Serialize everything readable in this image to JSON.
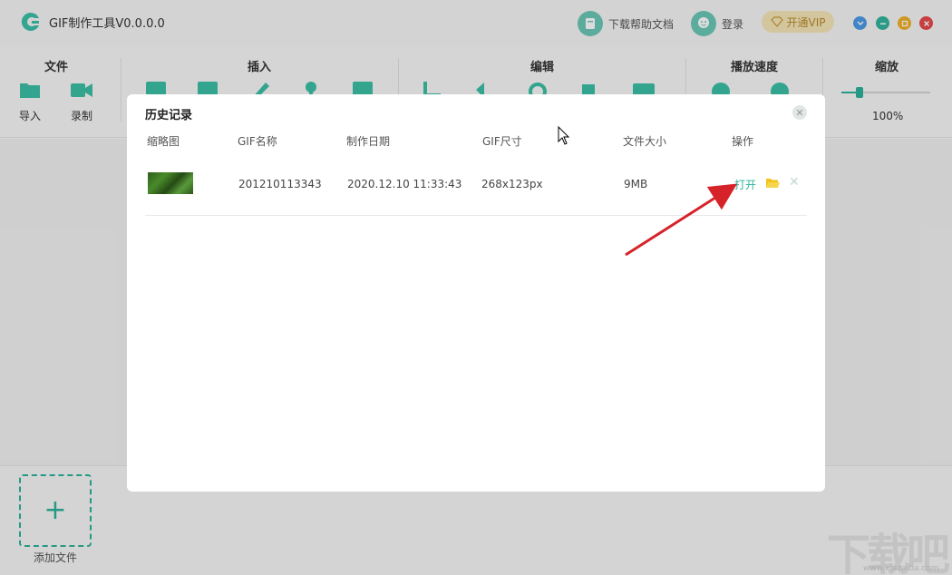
{
  "app": {
    "title": "GIF制作工具V0.0.0.0"
  },
  "titlebar": {
    "help_label": "下载帮助文档",
    "login_label": "登录",
    "vip_label": "开通VIP"
  },
  "toolbar": {
    "groups": {
      "file": "文件",
      "insert": "插入",
      "edit": "编辑",
      "speed": "播放速度",
      "zoom": "缩放"
    },
    "tools": {
      "import": "导入",
      "record": "录制"
    },
    "zoom_value": "100%",
    "zoom_level": 0.2
  },
  "sidebar": {
    "add_file_label": "添加文件"
  },
  "dialog": {
    "title": "历史记录",
    "columns": [
      "缩略图",
      "GIF名称",
      "制作日期",
      "GIF尺寸",
      "文件大小",
      "操作"
    ],
    "rows": [
      {
        "name": "201210113343",
        "date": "2020.12.10 11:33:43",
        "size": "268x123px",
        "filesize": "9MB",
        "open_label": "打开"
      }
    ]
  },
  "watermark": {
    "text": "下载吧",
    "url": "www.xiazaiba.com"
  },
  "colors": {
    "accent": "#2cb39b",
    "vip": "#f6e7b9",
    "arrow": "#d6232a"
  }
}
